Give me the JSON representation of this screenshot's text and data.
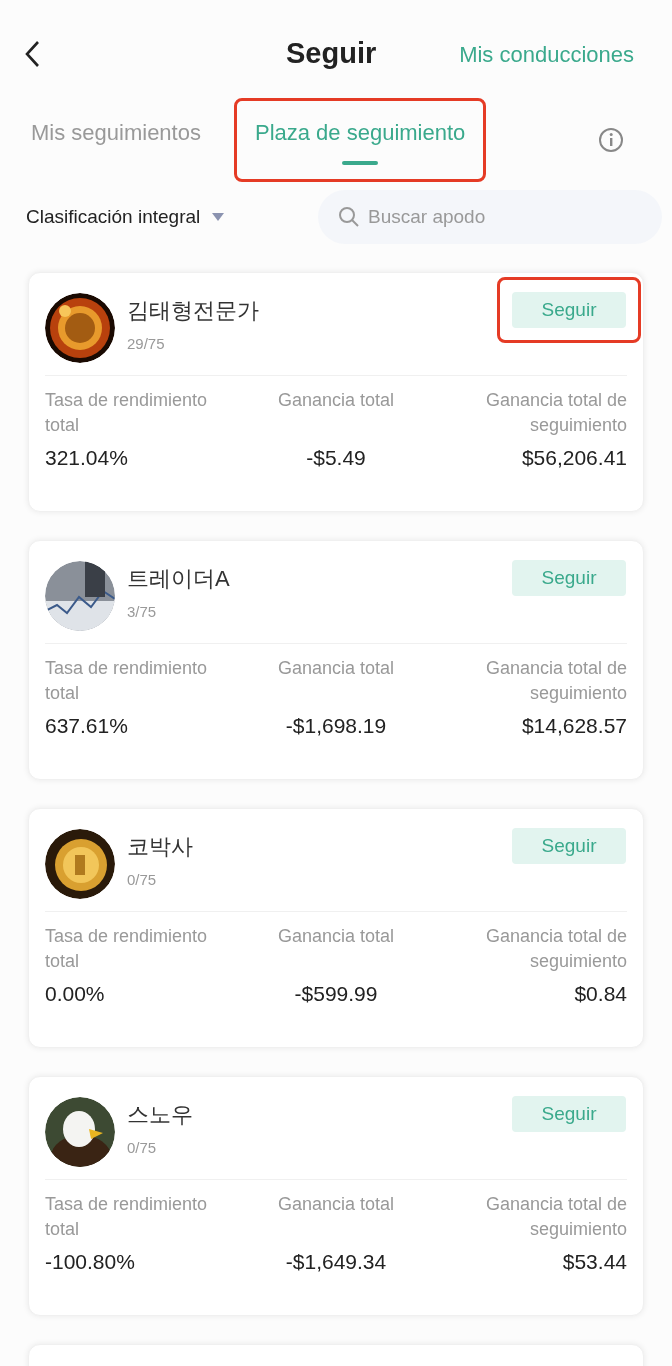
{
  "header": {
    "title": "Seguir",
    "action": "Mis conducciones"
  },
  "tabs": [
    {
      "label": "Mis seguimientos",
      "selected": false,
      "highlighted": false
    },
    {
      "label": "Plaza de seguimiento",
      "selected": true,
      "highlighted": true
    }
  ],
  "filter": {
    "sort": "Clasificación integral",
    "search_placeholder": "Buscar apodo"
  },
  "cards": [
    {
      "name": "김태형전문가",
      "count": "29/75",
      "button": {
        "label": "Seguir",
        "highlighted": true
      },
      "stats": [
        {
          "label": "Tasa de rendimiento total",
          "value": "321.04%"
        },
        {
          "label": "Ganancia total",
          "value": "-$5.49"
        },
        {
          "label": "Ganancia total de seguimiento",
          "value": "$56,206.41"
        }
      ]
    },
    {
      "name": "트레이더A",
      "count": "3/75",
      "button": {
        "label": "Seguir",
        "highlighted": false
      },
      "stats": [
        {
          "label": "Tasa de rendimiento total",
          "value": "637.61%"
        },
        {
          "label": "Ganancia total",
          "value": "-$1,698.19"
        },
        {
          "label": "Ganancia total de seguimiento",
          "value": "$14,628.57"
        }
      ]
    },
    {
      "name": "코박사",
      "count": "0/75",
      "button": {
        "label": "Seguir",
        "highlighted": false
      },
      "stats": [
        {
          "label": "Tasa de rendimiento total",
          "value": "0.00%"
        },
        {
          "label": "Ganancia total",
          "value": "-$599.99"
        },
        {
          "label": "Ganancia total de seguimiento",
          "value": "$0.84"
        }
      ]
    },
    {
      "name": "스노우",
      "count": "0/75",
      "button": {
        "label": "Seguir",
        "highlighted": false
      },
      "stats": [
        {
          "label": "Tasa de rendimiento total",
          "value": "-100.80%"
        },
        {
          "label": "Ganancia total",
          "value": "-$1,649.34"
        },
        {
          "label": "Ganancia total de seguimiento",
          "value": "$53.44"
        }
      ]
    }
  ]
}
